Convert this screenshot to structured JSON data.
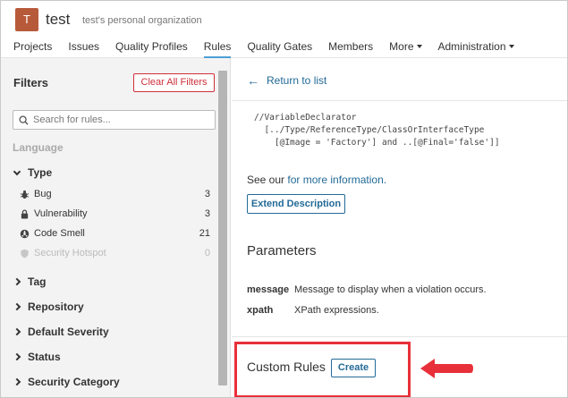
{
  "org": {
    "avatar_letter": "T",
    "name": "test",
    "description": "test's personal organization"
  },
  "nav": {
    "items": [
      {
        "label": "Projects"
      },
      {
        "label": "Issues"
      },
      {
        "label": "Quality Profiles"
      },
      {
        "label": "Rules",
        "active": true
      },
      {
        "label": "Quality Gates"
      },
      {
        "label": "Members"
      },
      {
        "label": "More",
        "dropdown": true
      },
      {
        "label": "Administration",
        "dropdown": true
      }
    ]
  },
  "sidebar": {
    "title": "Filters",
    "clear_label": "Clear All Filters",
    "search_placeholder": "Search for rules...",
    "language_label": "Language",
    "type_label": "Type",
    "type_facets": [
      {
        "label": "Bug",
        "count": "3",
        "icon": "bug-icon"
      },
      {
        "label": "Vulnerability",
        "count": "3",
        "icon": "lock-icon"
      },
      {
        "label": "Code Smell",
        "count": "21",
        "icon": "code-smell-icon"
      },
      {
        "label": "Security Hotspot",
        "count": "0",
        "icon": "shield-icon",
        "disabled": true
      }
    ],
    "sections": [
      "Tag",
      "Repository",
      "Default Severity",
      "Status",
      "Security Category"
    ]
  },
  "main": {
    "return_label": "Return to list",
    "code_lines": [
      "//VariableDeclarator",
      "  [../Type/ReferenceType/ClassOrInterfaceType",
      "    [@Image = 'Factory'] and ..[@Final='false']]"
    ],
    "see_prefix": "See our ",
    "see_link": "for more information.",
    "extend_label": "Extend Description",
    "parameters_title": "Parameters",
    "parameters": [
      {
        "key": "message",
        "value": "Message to display when a violation occurs."
      },
      {
        "key": "xpath",
        "value": "XPath expressions."
      }
    ],
    "custom_rules_title": "Custom Rules",
    "create_label": "Create"
  },
  "colors": {
    "link": "#236a97",
    "highlight": "#e8303a",
    "avatar": "#b75a3a",
    "danger": "#d02f3a"
  }
}
